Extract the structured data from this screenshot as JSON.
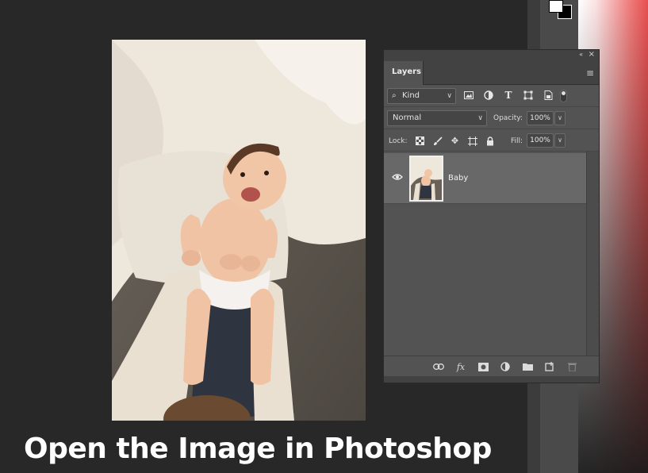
{
  "caption": "Open the Image in Photoshop",
  "colors": {
    "foreground": "#ffffff",
    "background": "#000000",
    "canvas": "#282828",
    "panel": "#535353"
  },
  "photo": {
    "subject": "baby"
  },
  "layers_panel": {
    "tab_label": "Layers",
    "collapse_icon": "double-chevron-icon",
    "close_icon": "close-icon",
    "menu_icon": "hamburger-menu-icon",
    "filter": {
      "kind_label": "Kind",
      "icons": [
        "image-filter-icon",
        "adjustment-filter-icon",
        "type-filter-icon",
        "shape-filter-icon",
        "smart-object-filter-icon"
      ]
    },
    "blend_mode": "Normal",
    "opacity_label": "Opacity:",
    "opacity_value": "100%",
    "lock_label": "Lock:",
    "lock_icons": [
      "lock-transparent-icon",
      "lock-image-icon",
      "lock-position-icon",
      "lock-artboard-icon",
      "lock-all-icon"
    ],
    "fill_label": "Fill:",
    "fill_value": "100%",
    "layers": [
      {
        "name": "Baby",
        "visible": true,
        "selected": true
      }
    ],
    "bottom_icons": [
      "link-icon",
      "fx-icon",
      "mask-icon",
      "adjustment-layer-icon",
      "group-folder-icon",
      "new-layer-icon",
      "trash-icon"
    ]
  }
}
